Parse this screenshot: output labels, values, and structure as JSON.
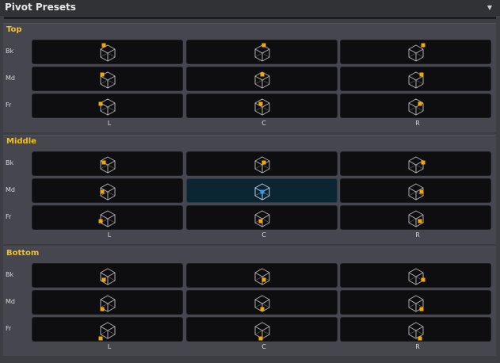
{
  "panel": {
    "title": "Pivot Presets",
    "dropdown_icon": "triangle-down-icon"
  },
  "row_labels": [
    "Bk",
    "Md",
    "Fr"
  ],
  "col_labels": [
    "L",
    "C",
    "R"
  ],
  "sections": [
    {
      "title": "Top"
    },
    {
      "title": "Middle"
    },
    {
      "title": "Bottom"
    }
  ],
  "selected": {
    "section": "Middle",
    "row": "Md",
    "col": "C"
  },
  "colors": {
    "accent": "#f2c21a",
    "pivot_marker": "#f5a800",
    "selected_marker": "#2f9bff",
    "cell_bg": "#0e0e11"
  }
}
